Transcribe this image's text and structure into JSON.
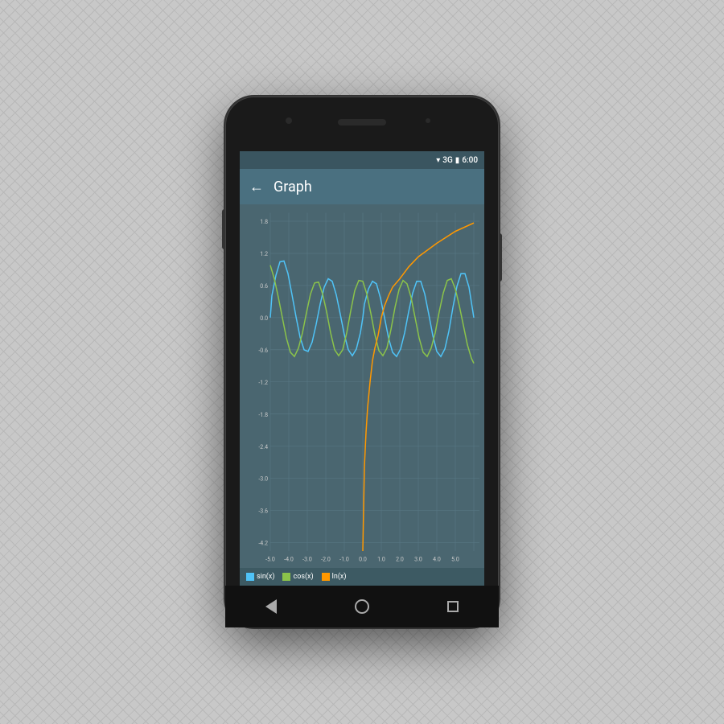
{
  "phone": {
    "status_bar": {
      "time": "6:00",
      "wifi_label": "▼",
      "signal_label": "3G"
    },
    "app_bar": {
      "back_label": "←",
      "title": "Graph"
    },
    "graph": {
      "y_axis_labels": [
        "1.8",
        "1.2",
        "0.6",
        "0.0",
        "-0.6",
        "-1.2",
        "-1.8",
        "-2.4",
        "-3.0",
        "-3.6",
        "-4.2"
      ],
      "x_axis_labels": [
        "-5.0",
        "-4.0",
        "-3.0",
        "-2.0",
        "-1.0",
        "0.0",
        "1.0",
        "2.0",
        "3.0",
        "4.0",
        "5.0"
      ],
      "colors": {
        "background": "#4a6670",
        "grid": "#5a7680",
        "sin_color": "#4fc3f7",
        "cos_color": "#8bc34a",
        "ln_color": "#ff9800"
      }
    },
    "legend": {
      "items": [
        {
          "label": "sin(x)",
          "color": "#4fc3f7"
        },
        {
          "label": "cos(x)",
          "color": "#8bc34a"
        },
        {
          "label": "ln(x)",
          "color": "#ff9800"
        }
      ]
    },
    "nav": {
      "back_label": "◁",
      "home_label": "○",
      "recent_label": "□"
    }
  }
}
